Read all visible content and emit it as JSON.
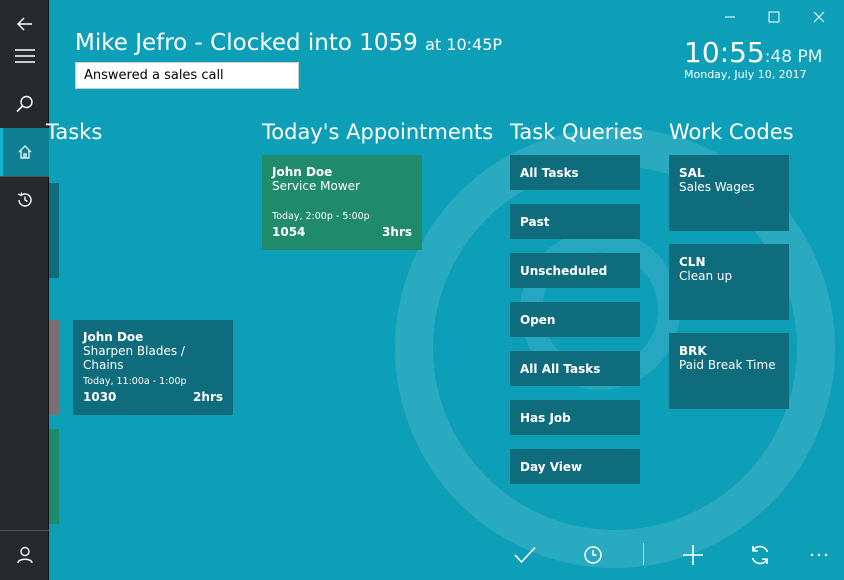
{
  "header": {
    "title_main": "Mike Jefro - Clocked into 1059",
    "title_at": "at 10:45P",
    "note_value": "Answered a sales call"
  },
  "clock": {
    "time": "10:55",
    "ampm": ":48 PM",
    "date": "Monday, July 10, 2017"
  },
  "sections": {
    "tasks": "Tasks",
    "appointments": "Today's Appointments",
    "queries": "Task Queries",
    "work_codes": "Work Codes"
  },
  "task_tile": {
    "name": "John Doe",
    "service": "Sharpen Blades /  Chains",
    "time": "Today, 11:00a - 1:00p",
    "job": "1030",
    "hours": "2hrs"
  },
  "appointment_tile": {
    "name": "John Doe",
    "service": "Service Mower",
    "time": "Today, 2:00p - 5:00p",
    "job": "1054",
    "hours": "3hrs"
  },
  "queries": [
    {
      "label": "All Tasks"
    },
    {
      "label": "Past"
    },
    {
      "label": "Unscheduled"
    },
    {
      "label": "Open"
    },
    {
      "label": "All All Tasks"
    },
    {
      "label": "Has Job"
    },
    {
      "label": "Day View"
    }
  ],
  "work_codes": [
    {
      "code": "SAL",
      "desc": "Sales Wages"
    },
    {
      "code": "CLN",
      "desc": "Clean up"
    },
    {
      "code": "BRK",
      "desc": "Paid Break Time"
    }
  ],
  "sidebar_icons": [
    "back-arrow-icon",
    "hamburger-menu-icon",
    "search-icon",
    "home-icon",
    "history-icon",
    "user-icon"
  ],
  "bottom_icons": [
    "check-icon",
    "clock-icon",
    "add-icon",
    "refresh-icon",
    "more-icon"
  ],
  "colors": {
    "background": "#0d9fb8",
    "tile": "#0f6c7c",
    "appointment": "#1f8b6a",
    "sidebar": "#262a2c"
  }
}
